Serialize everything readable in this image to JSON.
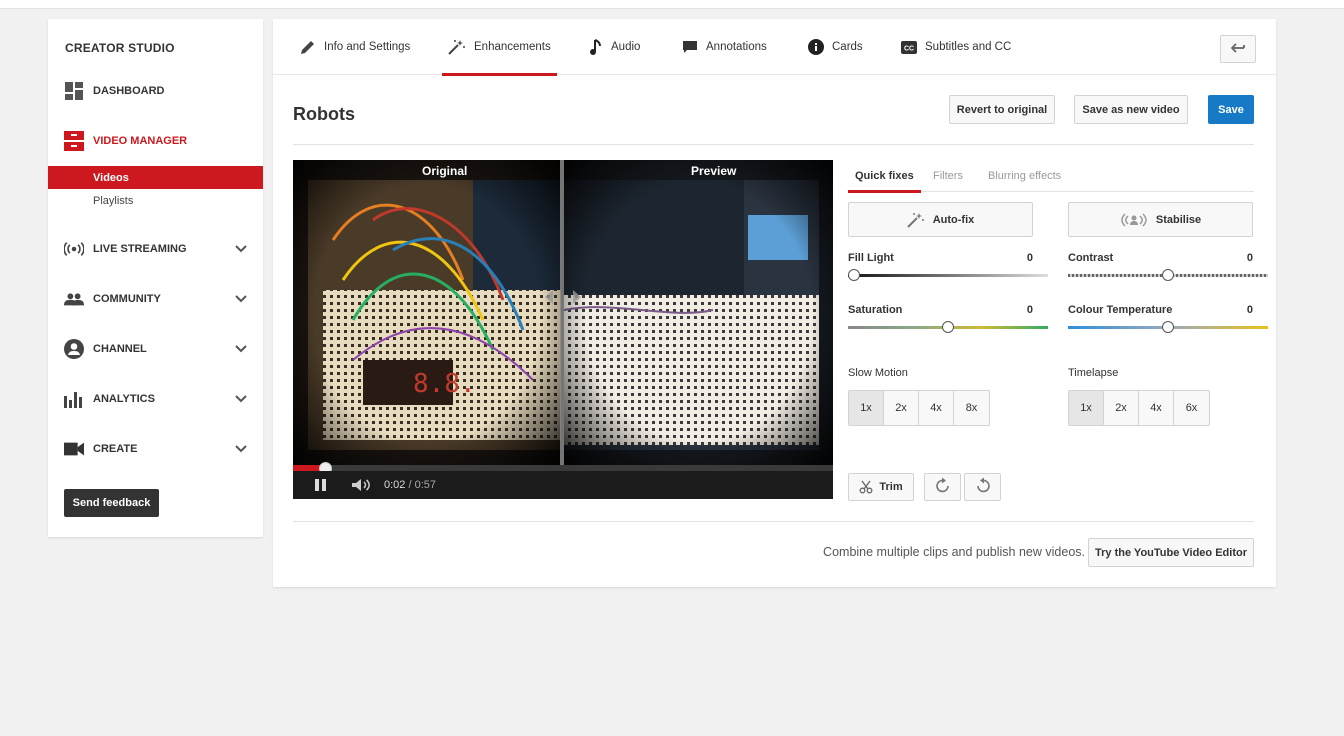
{
  "sidebar": {
    "title": "CREATOR STUDIO",
    "items": [
      {
        "label": "DASHBOARD",
        "icon": "dashboard-icon"
      },
      {
        "label": "VIDEO MANAGER",
        "icon": "video-manager-icon",
        "active": true
      },
      {
        "label": "LIVE STREAMING",
        "icon": "live-streaming-icon"
      },
      {
        "label": "COMMUNITY",
        "icon": "community-icon"
      },
      {
        "label": "CHANNEL",
        "icon": "channel-icon"
      },
      {
        "label": "ANALYTICS",
        "icon": "analytics-icon"
      },
      {
        "label": "CREATE",
        "icon": "create-icon"
      }
    ],
    "sub_items": [
      {
        "label": "Videos",
        "active": true
      },
      {
        "label": "Playlists"
      }
    ],
    "feedback_label": "Send feedback"
  },
  "tabs": [
    {
      "label": "Info and Settings",
      "icon": "pencil-icon"
    },
    {
      "label": "Enhancements",
      "icon": "magic-wand-icon",
      "active": true
    },
    {
      "label": "Audio",
      "icon": "music-note-icon"
    },
    {
      "label": "Annotations",
      "icon": "speech-bubble-icon"
    },
    {
      "label": "Cards",
      "icon": "info-icon"
    },
    {
      "label": "Subtitles and CC",
      "icon": "cc-icon"
    }
  ],
  "video": {
    "title": "Robots",
    "original_label": "Original",
    "preview_label": "Preview",
    "current_time": "0:02",
    "duration": "/ 0:57",
    "progress_fraction": 0.06
  },
  "actions": {
    "revert_label": "Revert to original",
    "save_new_label": "Save as new video",
    "save_label": "Save"
  },
  "enhance_tabs": [
    {
      "label": "Quick fixes",
      "active": true
    },
    {
      "label": "Filters"
    },
    {
      "label": "Blurring effects"
    }
  ],
  "quick_fixes": {
    "autofix_label": "Auto-fix",
    "stabilise_label": "Stabilise",
    "sliders": [
      {
        "label": "Fill Light",
        "value": "0",
        "position_fraction": 0.0
      },
      {
        "label": "Contrast",
        "value": "0",
        "position_fraction": 0.5
      },
      {
        "label": "Saturation",
        "value": "0",
        "position_fraction": 0.5
      },
      {
        "label": "Colour Temperature",
        "value": "0",
        "position_fraction": 0.5
      }
    ],
    "slow_motion": {
      "label": "Slow Motion",
      "options": [
        "1x",
        "2x",
        "4x",
        "8x"
      ],
      "selected": "1x"
    },
    "timelapse": {
      "label": "Timelapse",
      "options": [
        "1x",
        "2x",
        "4x",
        "6x"
      ],
      "selected": "1x"
    },
    "trim_label": "Trim"
  },
  "promo": {
    "text": "Combine multiple clips and publish new videos.",
    "button_label": "Try the YouTube Video Editor"
  },
  "colors": {
    "accent_red": "#cc181e",
    "primary_blue": "#167ac6"
  }
}
